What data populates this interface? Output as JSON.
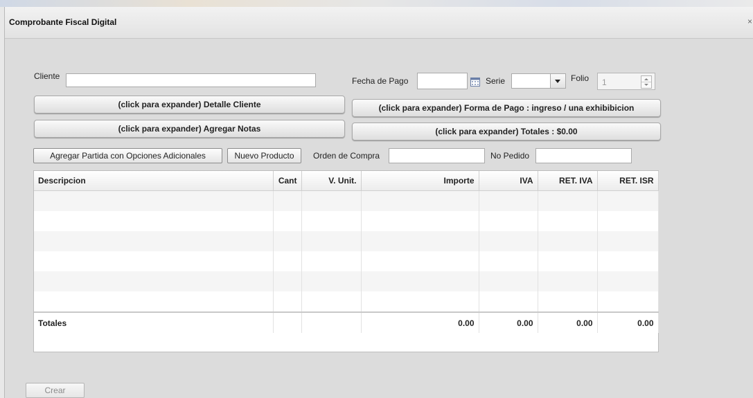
{
  "window": {
    "title": "Comprobante Fiscal Digital",
    "close_glyph": "×"
  },
  "form": {
    "cliente_label": "Cliente",
    "cliente_value": "",
    "fecha_pago_label": "Fecha de Pago",
    "fecha_pago_value": "",
    "serie_label": "Serie",
    "serie_value": "",
    "folio_label": "Folio",
    "folio_value": "1",
    "orden_compra_label": "Orden de Compra",
    "orden_compra_value": "",
    "no_pedido_label": "No Pedido",
    "no_pedido_value": ""
  },
  "expanders": {
    "detalle_cliente": "(click para expander) Detalle Cliente",
    "agregar_notas": "(click para expander) Agregar Notas",
    "forma_pago": "(click para expander) Forma de Pago : ingreso / una exhibibicion",
    "totales": "(click para expander) Totales : $0.00"
  },
  "actions": {
    "agregar_partida": "Agregar Partida con Opciones Adicionales",
    "nuevo_producto": "Nuevo Producto",
    "crear": "Crear"
  },
  "grid": {
    "columns": [
      "Descripcion",
      "Cant",
      "V. Unit.",
      "Importe",
      "IVA",
      "RET. IVA",
      "RET. ISR"
    ],
    "totals": {
      "label": "Totales",
      "cant": "",
      "vunit": "",
      "importe": "0.00",
      "iva": "0.00",
      "ret_iva": "0.00",
      "ret_isr": "0.00"
    }
  },
  "icons": {
    "calendar": "calendar-icon",
    "dropdown": "chevron-down-icon",
    "spinner": "spinner-icon"
  }
}
